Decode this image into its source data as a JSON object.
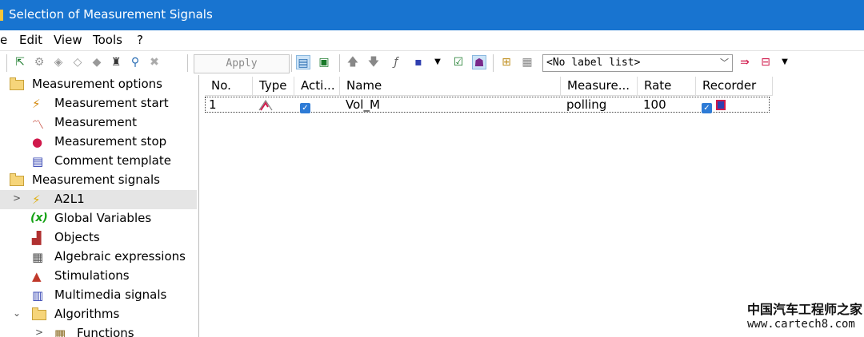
{
  "window": {
    "title": "Selection of Measurement Signals"
  },
  "menubar": {
    "items": [
      "e",
      "Edit",
      "View",
      "Tools",
      "?"
    ]
  },
  "toolbar": {
    "apply_label": "Apply",
    "label_list_value": "<No label list>"
  },
  "tree": {
    "items": [
      {
        "label": "Measurement options",
        "icon": "folder-icon"
      },
      {
        "label": "Measurement start",
        "icon": "measurement-start-icon"
      },
      {
        "label": "Measurement",
        "icon": "measurement-icon"
      },
      {
        "label": "Measurement stop",
        "icon": "measurement-stop-icon"
      },
      {
        "label": "Comment template",
        "icon": "comment-template-icon"
      },
      {
        "label": "Measurement signals",
        "icon": "folder-icon"
      },
      {
        "label": "A2L1",
        "icon": "a2l-icon"
      },
      {
        "label": "Global Variables",
        "icon": "global-variables-icon",
        "glyph": "(x)"
      },
      {
        "label": "Objects",
        "icon": "objects-icon"
      },
      {
        "label": "Algebraic expressions",
        "icon": "algebraic-expressions-icon"
      },
      {
        "label": "Stimulations",
        "icon": "stimulations-icon"
      },
      {
        "label": "Multimedia signals",
        "icon": "multimedia-signals-icon"
      },
      {
        "label": "Algorithms",
        "icon": "folder-icon"
      },
      {
        "label": "Functions",
        "icon": "functions-icon"
      }
    ]
  },
  "grid": {
    "columns": [
      "No.",
      "Type",
      "Acti...",
      "Name",
      "Measure...",
      "Rate",
      "Recorder"
    ],
    "rows": [
      {
        "no": "1",
        "name": "Vol_M",
        "measure": "polling",
        "rate": "100",
        "active": true,
        "recorder": true
      }
    ]
  },
  "watermark": {
    "line1": "中国汽车工程师之家",
    "line2": "www.cartech8.com"
  },
  "colors": {
    "titlebar": "#1874d0",
    "selection": "#e5e5e5",
    "checkbox": "#2d7bd6"
  }
}
